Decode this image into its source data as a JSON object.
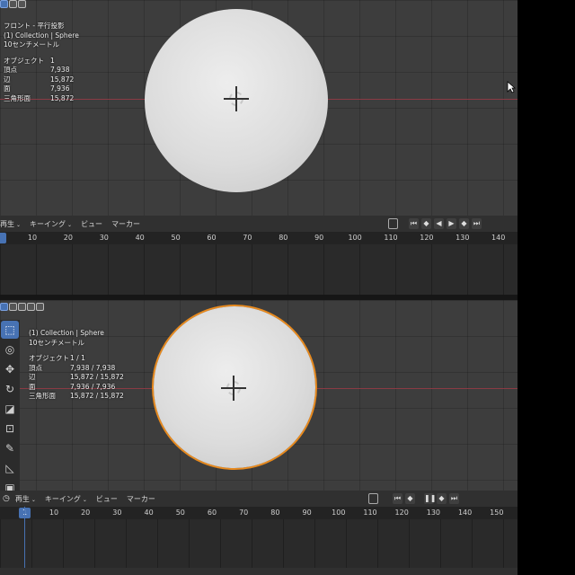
{
  "viewport_top": {
    "info_lines": [
      "フロント - 平行投影",
      "(1) Collection | Sphere",
      "10センチメートル"
    ],
    "stats": [
      {
        "label": "オブジェクト",
        "value": "1"
      },
      {
        "label": "頂点",
        "value": "7,938"
      },
      {
        "label": "辺",
        "value": "15,872"
      },
      {
        "label": "面",
        "value": "7,936"
      },
      {
        "label": "三角形面",
        "value": "15,872"
      }
    ]
  },
  "viewport_bottom": {
    "info_lines": [
      "(1) Collection | Sphere",
      "10センチメートル"
    ],
    "stats": [
      {
        "label": "オブジェクト",
        "value": "1 / 1"
      },
      {
        "label": "頂点",
        "value": "7,938 / 7,938"
      },
      {
        "label": "辺",
        "value": "15,872 / 15,872"
      },
      {
        "label": "面",
        "value": "7,936 / 7,936"
      },
      {
        "label": "三角形面",
        "value": "15,872 / 15,872"
      }
    ],
    "tools": [
      "select-box-icon",
      "cursor-icon",
      "move-icon",
      "rotate-icon",
      "scale-icon",
      "transform-icon",
      "annotate-icon",
      "measure-icon",
      "add-cube-icon"
    ]
  },
  "timeline_top": {
    "menus": [
      "再生",
      "キーイング",
      "ビュー",
      "マーカー"
    ],
    "ticks": [
      "10",
      "20",
      "30",
      "40",
      "50",
      "60",
      "70",
      "80",
      "90",
      "100",
      "110",
      "120",
      "130",
      "140"
    ],
    "current_frame": ""
  },
  "timeline_bottom": {
    "menus": [
      "再生",
      "キーイング",
      "ビュー",
      "マーカー"
    ],
    "ticks": [
      "10",
      "20",
      "30",
      "40",
      "50",
      "60",
      "70",
      "80",
      "90",
      "100",
      "110",
      "120",
      "130",
      "140",
      "150"
    ],
    "current_frame": "1"
  },
  "colors": {
    "selection_outline": "#e88a1e",
    "accent_blue": "#4772b3",
    "x_axis_line": "#8a3b44"
  }
}
